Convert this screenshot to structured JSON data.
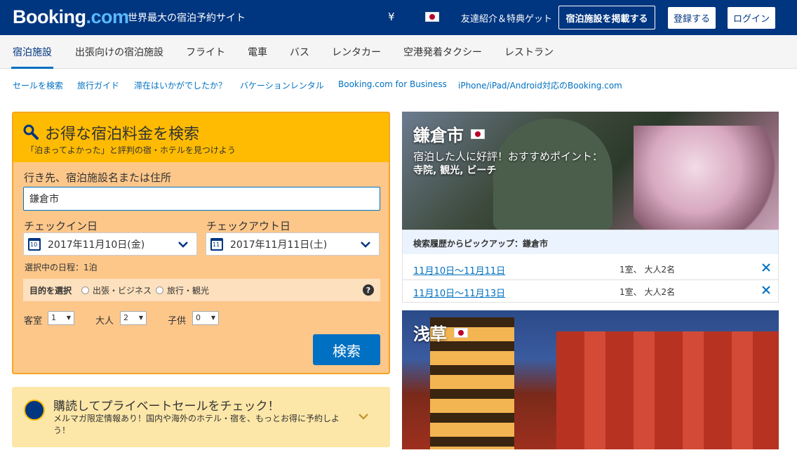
{
  "header": {
    "logo_main": "Booking",
    "logo_suffix": ".com",
    "tagline": "世界最大の宿泊予約サイト",
    "currency": "¥",
    "referral": "友達紹介＆特典ゲット",
    "list_property": "宿泊施設を掲載する",
    "register": "登録する",
    "login": "ログイン"
  },
  "nav": {
    "tabs": [
      {
        "label": "宿泊施設"
      },
      {
        "label": "出張向けの宿泊施設"
      },
      {
        "label": "フライト"
      },
      {
        "label": "電車"
      },
      {
        "label": "バス"
      },
      {
        "label": "レンタカー"
      },
      {
        "label": "空港発着タクシー"
      },
      {
        "label": "レストラン"
      }
    ],
    "active_index": 0
  },
  "sublinks": [
    {
      "label": "セールを検索"
    },
    {
      "label": "旅行ガイド"
    },
    {
      "label": "滞在はいかがでしたか？"
    },
    {
      "label": "バケーションレンタル"
    },
    {
      "label": "Booking.com for Business"
    },
    {
      "label": "iPhone/iPad/Android対応のBooking.com"
    }
  ],
  "search": {
    "title": "お得な宿泊料金を検索",
    "subtitle": "「泊まってよかった」と評判の宿・ホテルを見つけよう",
    "destination_label": "行き先、宿泊施設名または住所",
    "destination_value": "鎌倉市",
    "checkin_label": "チェックイン日",
    "checkin_value": "2017年11月10日(金)",
    "checkin_day": "10",
    "checkout_label": "チェックアウト日",
    "checkout_value": "2017年11月11日(土)",
    "checkout_day": "11",
    "nights": "選択中の日程：1泊",
    "purpose_label": "目的を選択",
    "purpose_business": "出張・ビジネス",
    "purpose_leisure": "旅行・観光",
    "help": "?",
    "rooms_label": "客室",
    "rooms_value": "1",
    "adults_label": "大人",
    "adults_value": "2",
    "children_label": "子供",
    "children_value": "0",
    "submit": "検索"
  },
  "newsletter": {
    "title": "購読してプライベートセールをチェック！",
    "text": "メルマガ限定情報あり！国内や海外のホテル・宿を、もっとお得に予約しよう！"
  },
  "cards": [
    {
      "title": "鎌倉市",
      "line1": "宿泊した人に好評！おすすめポイント：",
      "line2": "寺院, 観光, ビーチ"
    },
    {
      "title": "浅草"
    }
  ],
  "history": {
    "heading": "検索履歴からピックアップ：鎌倉市",
    "rows": [
      {
        "dates": "11月10日〜11月11日",
        "guests": "1室、 大人2名"
      },
      {
        "dates": "11月10日〜11月13日",
        "guests": "1室、 大人2名"
      }
    ]
  },
  "colors": {
    "brand_navy": "#003580",
    "accent_blue": "#0071c2",
    "search_yellow": "#febb02"
  }
}
